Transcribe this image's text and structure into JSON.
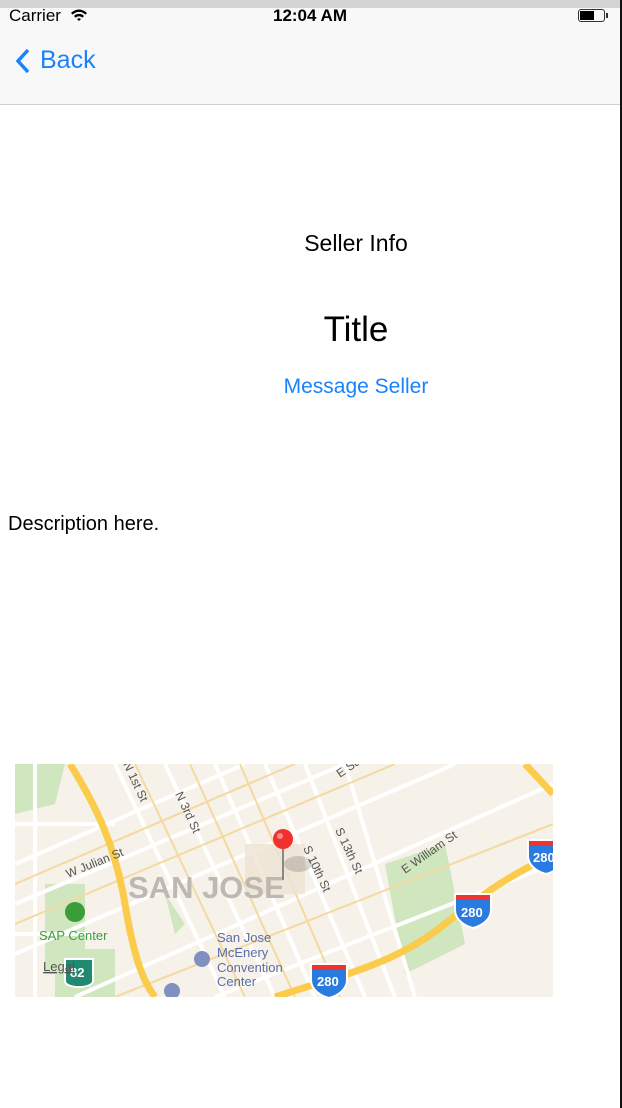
{
  "status_bar": {
    "carrier": "Carrier",
    "time": "12:04 AM",
    "battery_level": 0.6
  },
  "nav": {
    "back_label": "Back"
  },
  "content": {
    "section_label": "Seller Info",
    "title": "Title",
    "message_button": "Message Seller",
    "description": "Description here."
  },
  "map": {
    "city_label": "SAN JOSE",
    "streets": [
      "N 1st St",
      "N 3rd St",
      "W Julian St",
      "S 10th St",
      "S 13th St",
      "E William St",
      "E Sa"
    ],
    "poi": [
      "SAP Center",
      "San Jose",
      "McEnery",
      "Convention",
      "Center"
    ],
    "highway_shields": [
      "280",
      "280",
      "280",
      "82"
    ],
    "legal": "Legal",
    "colors": {
      "land": "#f6f1e9",
      "park": "#cfe6bf",
      "highway": "#fbcb4b",
      "road": "#ffffff",
      "pin": "#f0312f",
      "shield": "#2a7be0",
      "poi_blue": "#5a6fa8",
      "poi_green": "#3a9d3a"
    }
  }
}
